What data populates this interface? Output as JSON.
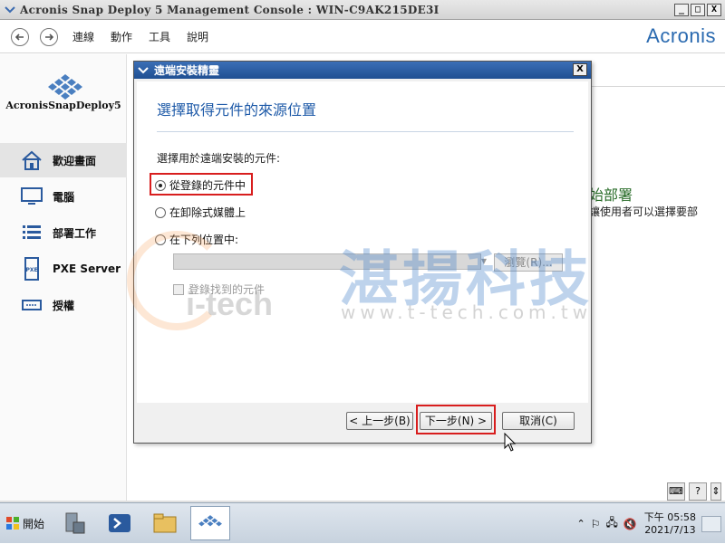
{
  "window": {
    "title": "Acronis Snap Deploy 5 Management Console : WIN-C9AK215DE3I",
    "minimize": "_",
    "maximize": "□",
    "close": "X"
  },
  "toolbar": {
    "menus": [
      "連線",
      "動作",
      "工具",
      "說明"
    ],
    "brand": "Acronis"
  },
  "sidebar": {
    "logo_text": "AcronisSnapDeploy5",
    "items": [
      {
        "label": "歡迎畫面",
        "icon": "home-icon"
      },
      {
        "label": "電腦",
        "icon": "monitor-icon"
      },
      {
        "label": "部署工作",
        "icon": "list-icon"
      },
      {
        "label": "PXE Server",
        "icon": "pxe-server-icon"
      },
      {
        "label": "授權",
        "icon": "license-icon"
      }
    ]
  },
  "background": {
    "title": "始部署",
    "desc": "讓使用者可以選擇要部"
  },
  "watermark": {
    "chinese": "湛揚科技",
    "url": "www.t-tech.com.tw",
    "logo": "i-tech"
  },
  "dialog": {
    "title": "遠端安裝精靈",
    "close": "X",
    "heading": "選擇取得元件的來源位置",
    "label": "選擇用於遠端安裝的元件:",
    "options": [
      {
        "label": "從登錄的元件中",
        "checked": true
      },
      {
        "label": "在卸除式媒體上",
        "checked": false
      },
      {
        "label": "在下列位置中:",
        "checked": false
      }
    ],
    "browse_label": "瀏覽(R)...",
    "checkbox_label": "登錄找到的元件",
    "buttons": {
      "back": "< 上一步(B)",
      "next": "下一步(N) >",
      "cancel": "取消(C)"
    }
  },
  "taskbar": {
    "start_label": "開始",
    "time": "下午 05:58",
    "date": "2021/7/13"
  },
  "colors": {
    "accent": "#1e5aa8",
    "highlight": "#d81e1e",
    "titlebar": "#2a5a9e"
  }
}
